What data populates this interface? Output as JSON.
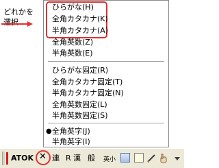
{
  "callout": {
    "line1": "どれかを",
    "line2": "選択"
  },
  "menu": {
    "items_top": [
      {
        "label": "ひらがな(H)"
      },
      {
        "label": "全角カタカナ(K)"
      },
      {
        "label": "半角カタカナ(A)"
      },
      {
        "label": "全角英数(Z)"
      },
      {
        "label": "半角英数(E)"
      }
    ],
    "items_fixed": [
      {
        "label": "ひらがな固定(R)"
      },
      {
        "label": "全角カタカナ固定(T)"
      },
      {
        "label": "半角カタカナ固定(N)"
      },
      {
        "label": "全角英数固定(L)"
      },
      {
        "label": "半角英数固定(S)"
      }
    ],
    "items_char": [
      {
        "label": "全角英字(J)",
        "selected": true
      },
      {
        "label": "半角英字(I)",
        "selected": false
      }
    ],
    "bullet": "●"
  },
  "toolbar": {
    "atok_label": "ATOK",
    "mode_symbol": "✕",
    "ren_label": "連",
    "r_label": "R",
    "kan_label": "漢",
    "han_label": "般",
    "eishou_label": "英小",
    "icons": [
      "calculator-icon",
      "note-icon",
      "pen-icon",
      "hand-icon",
      "dropdown-icon"
    ],
    "accent_color": "#e03030"
  }
}
